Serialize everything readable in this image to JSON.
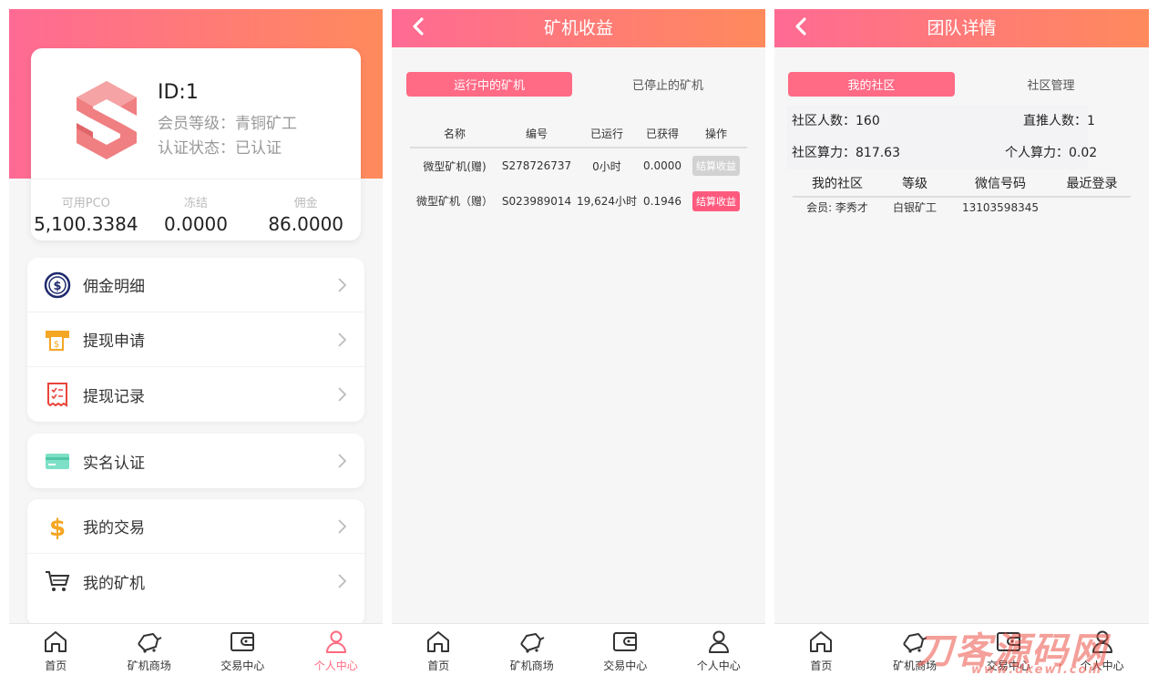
{
  "profile": {
    "id": "ID:1",
    "level": "会员等级：青铜矿工",
    "status": "认证状态：已认证",
    "stats": [
      {
        "label": "可用PCO",
        "value": "5,100.3384"
      },
      {
        "label": "冻结",
        "value": "0.0000"
      },
      {
        "label": "佣金",
        "value": "86.0000"
      }
    ]
  },
  "menu": {
    "group1": [
      {
        "label": "佣金明细",
        "icon": "dollar-circle-icon"
      },
      {
        "label": "提现申请",
        "icon": "atm-icon"
      },
      {
        "label": "提现记录",
        "icon": "receipt-icon"
      }
    ],
    "group2": [
      {
        "label": "实名认证",
        "icon": "card-icon"
      }
    ],
    "group3": [
      {
        "label": "我的交易",
        "icon": "dollar-sign-icon"
      },
      {
        "label": "我的矿机",
        "icon": "cart-icon"
      }
    ]
  },
  "tabbar": [
    {
      "label": "首页",
      "icon": "home-icon"
    },
    {
      "label": "矿机商场",
      "icon": "miner-icon"
    },
    {
      "label": "交易中心",
      "icon": "wallet-icon"
    },
    {
      "label": "个人中心",
      "icon": "person-icon"
    }
  ],
  "earnings": {
    "title": "矿机收益",
    "tabs": [
      "运行中的矿机",
      "已停止的矿机"
    ],
    "columns": [
      "名称",
      "编号",
      "已运行",
      "已获得",
      "操作"
    ],
    "rows": [
      {
        "name": "微型矿机(赠)",
        "code": "S278726737",
        "runtime": "0小时",
        "earned": "0.0000",
        "action": "结算收益"
      },
      {
        "name": "微型矿机（赠）",
        "code": "S023989014",
        "runtime": "19,624小时",
        "earned": "0.1946",
        "action": "结算收益"
      }
    ]
  },
  "team": {
    "title": "团队详情",
    "tabs": [
      "我的社区",
      "社区管理"
    ],
    "community_count": "社区人数：160",
    "direct_count": "直推人数：1",
    "community_power": "社区算力：817.63",
    "personal_power": "个人算力：0.02",
    "columns": [
      "我的社区",
      "等级",
      "微信号码",
      "最近登录"
    ],
    "rows": [
      {
        "member": "会员: 李秀才",
        "level": "白银矿工",
        "wechat": "13103598345",
        "last_login": ""
      }
    ]
  },
  "watermark": {
    "main": "刀客源码网",
    "sub": "www.dkewl.com"
  },
  "colors": {
    "accent": "#ff6a85",
    "gradient_start": "#ff6a94",
    "gradient_end": "#ff8a5c"
  }
}
